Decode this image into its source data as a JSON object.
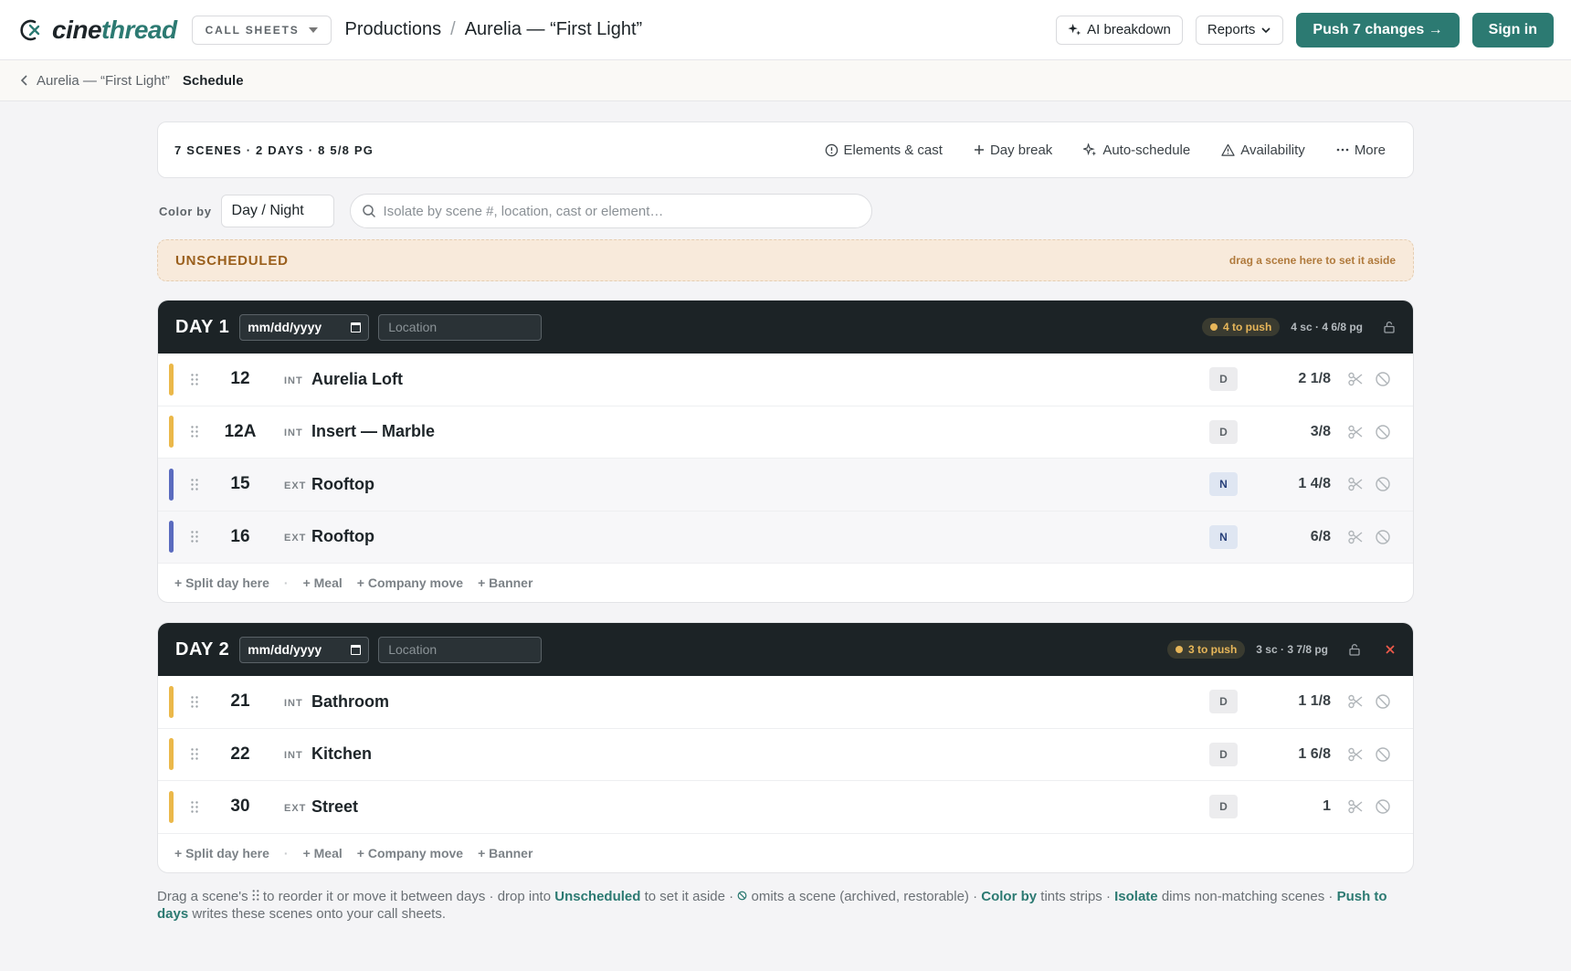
{
  "app": {
    "brand_prefix": "cine",
    "brand_suffix": "thread",
    "module": "CALL SHEETS",
    "breadcrumb_root": "Productions",
    "breadcrumb_sep": "/",
    "breadcrumb_project": "Aurelia — “First Light”",
    "ai_label": "AI breakdown",
    "reports_label": "Reports",
    "push_label": "Push 7 changes →",
    "signin_label": "Sign in"
  },
  "subnav": {
    "back_label": "Aurelia — “First Light”",
    "current": "Schedule"
  },
  "toolbar": {
    "summary": "7 SCENES · 2 DAYS · 8 5/8 PG",
    "elements": "Elements & cast",
    "daybreak": "Day break",
    "autoschedule": "Auto-schedule",
    "availability": "Availability",
    "more": "More"
  },
  "filters": {
    "color_by_label": "Color by",
    "color_by_value": "Day / Night",
    "search_placeholder": "Isolate by scene #, location, cast or element…"
  },
  "unscheduled": {
    "label": "UNSCHEDULED",
    "hint": "drag a scene here to set it aside"
  },
  "days": [
    {
      "title": "DAY 1",
      "date_placeholder": "mm/dd/yyyy",
      "location_placeholder": "Location",
      "push_badge": "4 to push",
      "stats": "4 sc · 4 6/8 pg",
      "removable": false,
      "scenes": [
        {
          "num": "12",
          "ie": "INT",
          "name": "Aurelia Loft",
          "dn": "D",
          "pages": "2 1/8"
        },
        {
          "num": "12A",
          "ie": "INT",
          "name": "Insert — Marble",
          "dn": "D",
          "pages": "3/8"
        },
        {
          "num": "15",
          "ie": "EXT",
          "name": "Rooftop",
          "dn": "N",
          "pages": "1 4/8"
        },
        {
          "num": "16",
          "ie": "EXT",
          "name": "Rooftop",
          "dn": "N",
          "pages": "6/8"
        }
      ]
    },
    {
      "title": "DAY 2",
      "date_placeholder": "mm/dd/yyyy",
      "location_placeholder": "Location",
      "push_badge": "3 to push",
      "stats": "3 sc · 3 7/8 pg",
      "removable": true,
      "scenes": [
        {
          "num": "21",
          "ie": "INT",
          "name": "Bathroom",
          "dn": "D",
          "pages": "1 1/8"
        },
        {
          "num": "22",
          "ie": "INT",
          "name": "Kitchen",
          "dn": "D",
          "pages": "1 6/8"
        },
        {
          "num": "30",
          "ie": "EXT",
          "name": "Street",
          "dn": "D",
          "pages": "1"
        }
      ]
    }
  ],
  "day_footer": {
    "split": "Split day here",
    "dot": "·",
    "meal": "Meal",
    "move": "Company move",
    "banner": "Banner"
  },
  "help": {
    "p1": "Drag a scene's ",
    "p2": " to reorder it or move it between days · drop into ",
    "k1": "Unscheduled",
    "p3": " to set it aside · ",
    "p4": " omits a scene (archived, restorable) · ",
    "k2": "Color by",
    "p5": " tints strips · ",
    "k3": "Isolate",
    "p6": " dims non-matching scenes · ",
    "k4": "Push to days",
    "p7": " writes these scenes onto your call sheets."
  },
  "colors": {
    "accent": "#2c7a72",
    "day_strip": "#ebb84a",
    "night_strip": "#5a6bbf",
    "header_dark": "#1c2326",
    "push_amber": "#e7b659",
    "danger": "#ef5a4a"
  }
}
